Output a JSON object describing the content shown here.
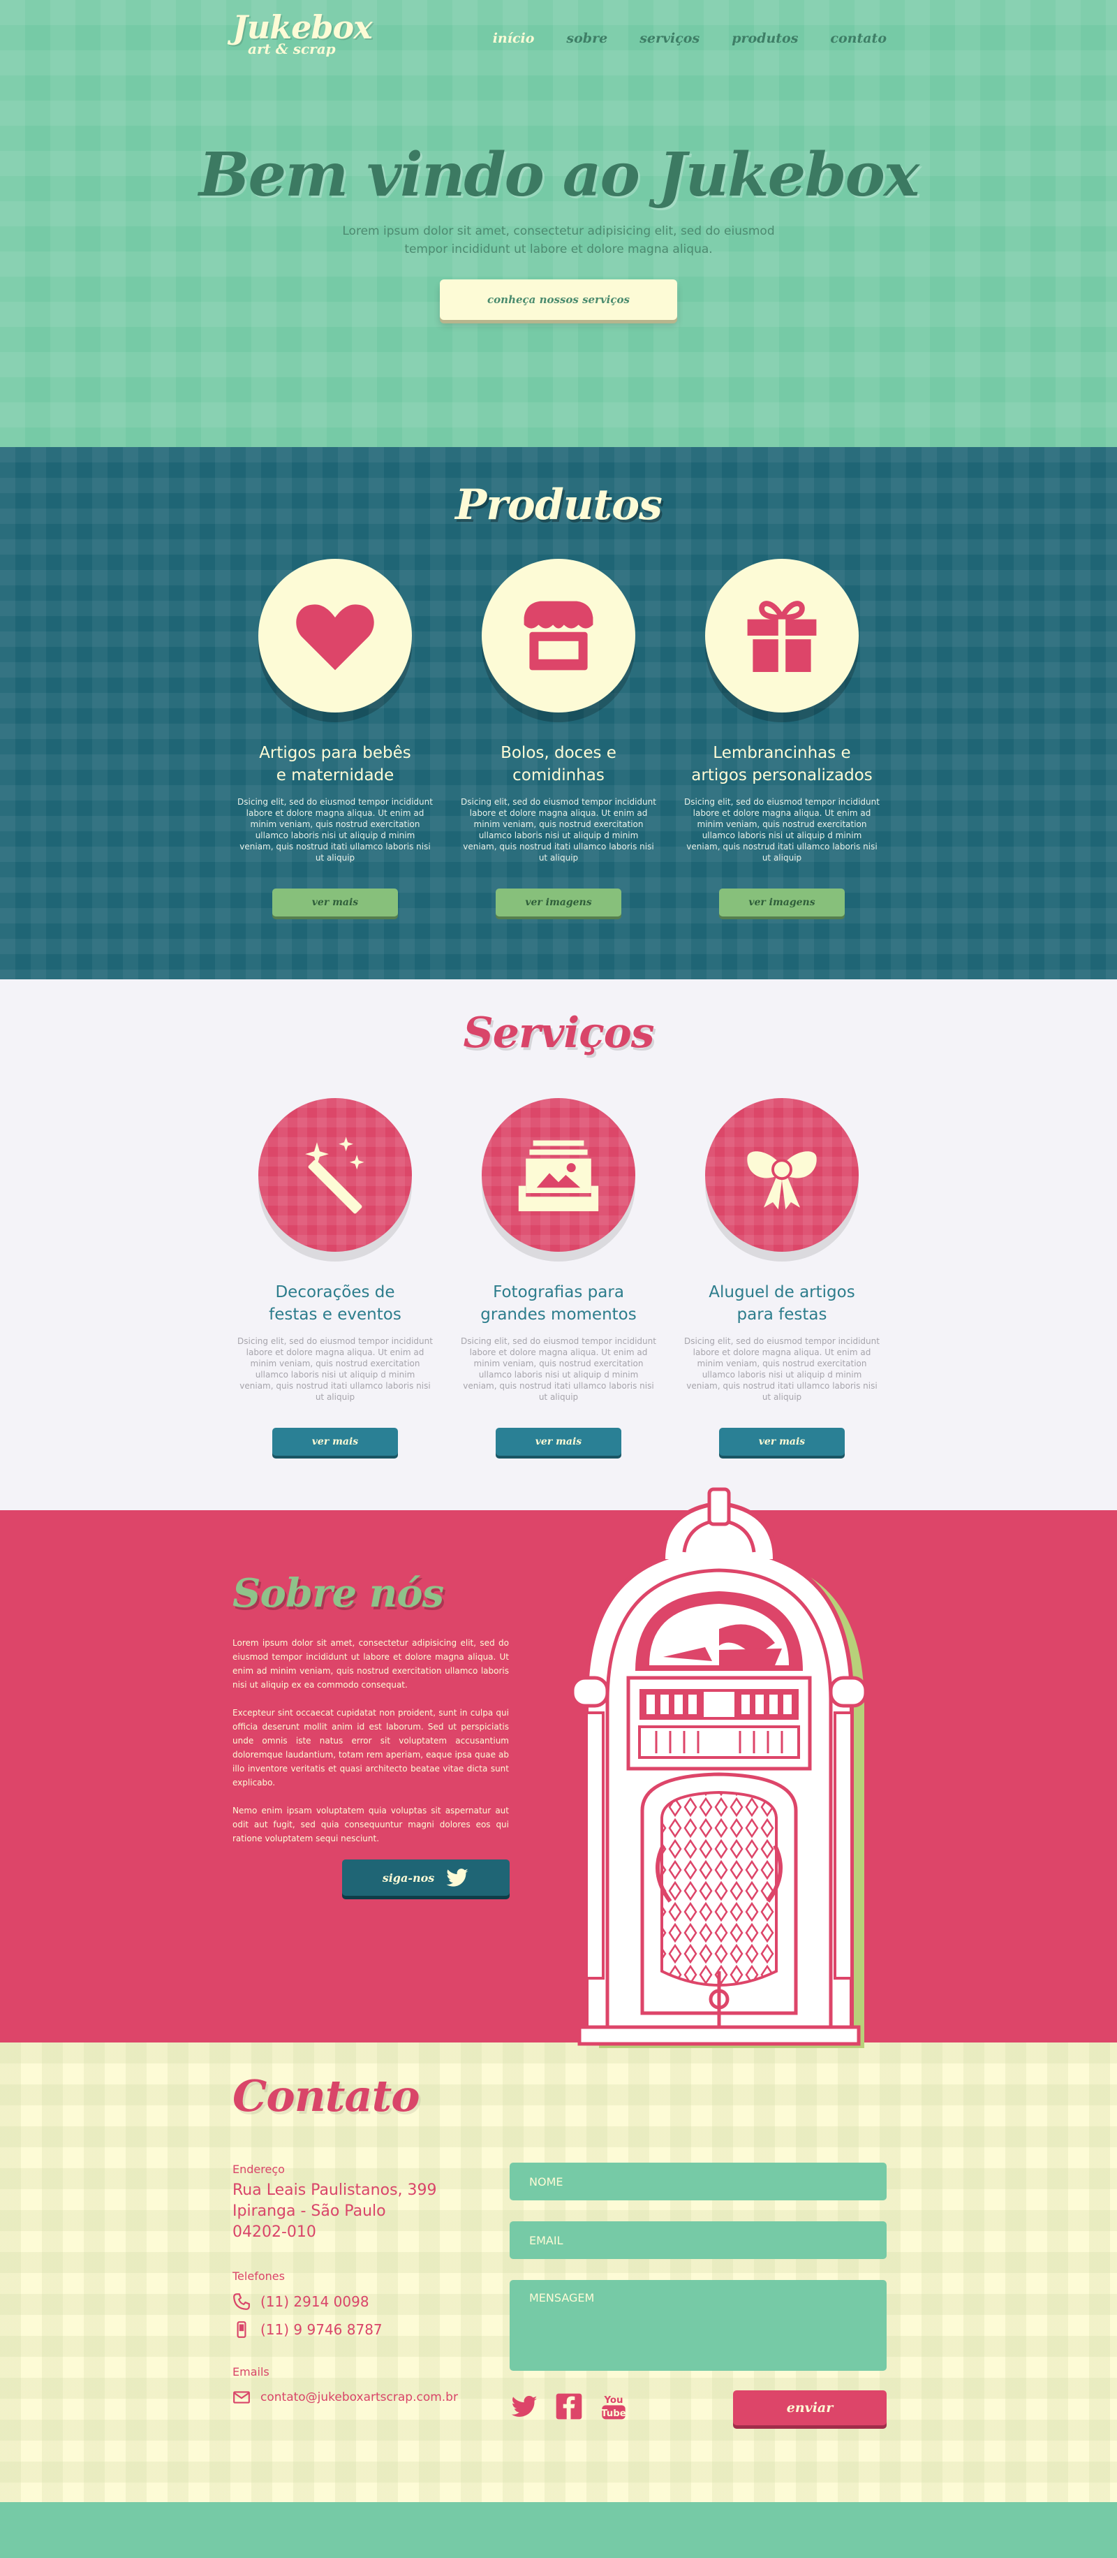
{
  "brand": {
    "name": "Jukebox",
    "tagline": "art & scrap"
  },
  "nav": {
    "items": [
      {
        "label": "início",
        "active": true
      },
      {
        "label": "sobre"
      },
      {
        "label": "serviços"
      },
      {
        "label": "produtos"
      },
      {
        "label": "contato"
      }
    ]
  },
  "hero": {
    "title": "Bem vindo ao Jukebox",
    "text_line1": "Lorem ipsum dolor sit amet, consectetur adipisicing elit, sed do eiusmod",
    "text_line2": "tempor incididunt ut labore et dolore magna aliqua.",
    "button": "conheça nossos serviços"
  },
  "produtos": {
    "title": "Produtos",
    "cards": [
      {
        "icon": "heart-icon",
        "title_line1": "Artigos para bebês",
        "title_line2": "e maternidade",
        "text": "Dsicing elit, sed do eiusmod tempor incididunt labore et dolore magna aliqua. Ut enim ad minim veniam, quis nostrud exercitation ullamco laboris nisi ut aliquip d minim veniam, quis nostrud itati ullamco laboris nisi ut aliquip",
        "button": "ver mais"
      },
      {
        "icon": "shop-icon",
        "title_line1": "Bolos, doces e",
        "title_line2": "comidinhas",
        "text": "Dsicing elit, sed do eiusmod tempor incididunt labore et dolore magna aliqua. Ut enim ad minim veniam, quis nostrud exercitation ullamco laboris nisi ut aliquip d minim veniam, quis nostrud itati ullamco laboris nisi ut aliquip",
        "button": "ver imagens"
      },
      {
        "icon": "gift-icon",
        "title_line1": "Lembrancinhas e",
        "title_line2": "artigos personalizados",
        "text": "Dsicing elit, sed do eiusmod tempor incididunt labore et dolore magna aliqua. Ut enim ad minim veniam, quis nostrud exercitation ullamco laboris nisi ut aliquip d minim veniam, quis nostrud itati ullamco laboris nisi ut aliquip",
        "button": "ver imagens"
      }
    ]
  },
  "servicos": {
    "title": "Serviços",
    "cards": [
      {
        "icon": "magic-wand-icon",
        "title_line1": "Decorações de",
        "title_line2": "festas e eventos",
        "text": "Dsicing elit, sed do eiusmod tempor incididunt labore et dolore magna aliqua. Ut enim ad minim veniam, quis nostrud exercitation ullamco laboris nisi ut aliquip d minim veniam, quis nostrud itati ullamco laboris nisi ut aliquip",
        "button": "ver mais"
      },
      {
        "icon": "photos-icon",
        "title_line1": "Fotografias para",
        "title_line2": "grandes momentos",
        "text": "Dsicing elit, sed do eiusmod tempor incididunt labore et dolore magna aliqua. Ut enim ad minim veniam, quis nostrud exercitation ullamco laboris nisi ut aliquip d minim veniam, quis nostrud itati ullamco laboris nisi ut aliquip",
        "button": "ver mais"
      },
      {
        "icon": "bow-icon",
        "title_line1": "Aluguel de artigos",
        "title_line2": "para festas",
        "text": "Dsicing elit, sed do eiusmod tempor incididunt labore et dolore magna aliqua. Ut enim ad minim veniam, quis nostrud exercitation ullamco laboris nisi ut aliquip d minim veniam, quis nostrud itati ullamco laboris nisi ut aliquip",
        "button": "ver mais"
      }
    ]
  },
  "sobre": {
    "title": "Sobre nós",
    "paragraphs": [
      "Lorem ipsum dolor sit amet, consectetur adipisicing elit, sed do eiusmod tempor incididunt ut labore et dolore magna aliqua. Ut enim ad minim veniam, quis nostrud exercitation ullamco laboris nisi ut aliquip ex ea commodo consequat.",
      "Excepteur sint occaecat cupidatat non proident, sunt in culpa qui officia deserunt mollit anim id est laborum. Sed ut perspiciatis unde omnis iste natus error sit voluptatem accusantium doloremque laudantium, totam rem aperiam, eaque ipsa quae ab illo inventore veritatis et quasi architecto beatae vitae dicta sunt explicabo.",
      "Nemo enim ipsam voluptatem quia voluptas sit aspernatur aut odit aut fugit, sed quia consequuntur magni dolores eos qui ratione voluptatem sequi nesciunt."
    ],
    "follow_button": "siga-nos",
    "illustration": "jukebox-illustration"
  },
  "contato": {
    "title": "Contato",
    "address_label": "Endereço",
    "address_line1": "Rua Leais Paulistanos, 399",
    "address_line2": "Ipiranga - São Paulo",
    "address_line3": "04202-010",
    "phones_label": "Telefones",
    "phone1": "(11) 2914 0098",
    "phone2": "(11) 9 9746 8787",
    "emails_label": "Emails",
    "email": "contato@jukeboxartscrap.com.br",
    "form": {
      "name_placeholder": "NOME",
      "email_placeholder": "EMAIL",
      "message_placeholder": "MENSAGEM",
      "send_button": "enviar"
    },
    "social": [
      "twitter-icon",
      "facebook-icon",
      "youtube-icon"
    ],
    "youtube_label_top": "You",
    "youtube_label_bottom": "Tube"
  },
  "colors": {
    "mint": "#76caa6",
    "teal": "#1f6575",
    "pink": "#dd4569",
    "cream": "#fdfbd6",
    "green_button": "#87c07b",
    "blue_button": "#2a8095"
  }
}
